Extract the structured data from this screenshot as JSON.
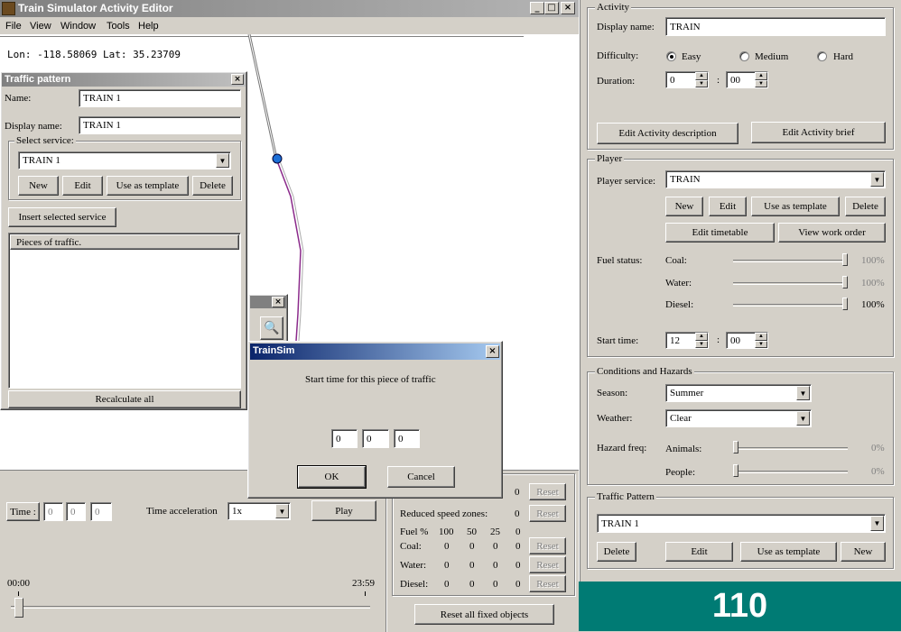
{
  "app": {
    "title": "Train Simulator Activity Editor"
  },
  "menu": [
    "File",
    "View",
    "Window",
    "Tools",
    "Help"
  ],
  "map": {
    "coords": "Lon: -118.58069 Lat: 35.23709"
  },
  "traffic_pattern_win": {
    "title": "Traffic pattern",
    "name_label": "Name:",
    "name_value": "TRAIN 1",
    "display_label": "Display name:",
    "display_value": "TRAIN 1",
    "select_service_label": "Select service:",
    "service_value": "TRAIN 1",
    "new": "New",
    "edit": "Edit",
    "use_template": "Use as template",
    "delete": "Delete",
    "insert": "Insert selected service",
    "pieces_header": "Pieces of traffic.",
    "recalc": "Recalculate all"
  },
  "dialog": {
    "title": "TrainSim",
    "prompt": "Start time for this piece of traffic",
    "h": "0",
    "m": "0",
    "s": "0",
    "ok": "OK",
    "cancel": "Cancel"
  },
  "bottom": {
    "time_label": "Time :",
    "time_h": "0",
    "time_m": "0",
    "time_s": "0",
    "accel_label": "Time acceleration",
    "accel_value": "1x",
    "play": "Play",
    "slider_start": "00:00",
    "slider_end": "23:59"
  },
  "fixed": {
    "row1_value": "0",
    "reset": "Reset",
    "reduced_label": "Reduced speed zones:",
    "reduced_value": "0",
    "fuel_header": "Fuel %",
    "h100": "100",
    "h50": "50",
    "h25": "25",
    "h0": "0",
    "coal": "Coal:",
    "water": "Water:",
    "diesel": "Diesel:",
    "zero": "0",
    "reset_all": "Reset all fixed objects"
  },
  "activity": {
    "group": "Activity",
    "display_label": "Display name:",
    "display_value": "TRAIN",
    "difficulty_label": "Difficulty:",
    "easy": "Easy",
    "medium": "Medium",
    "hard": "Hard",
    "duration_label": "Duration:",
    "dur_h": "0",
    "dur_m": "00",
    "edit_desc": "Edit Activity description",
    "edit_brief": "Edit Activity brief"
  },
  "player": {
    "group": "Player",
    "service_label": "Player service:",
    "service_value": "TRAIN",
    "new": "New",
    "edit": "Edit",
    "use_template": "Use as template",
    "delete": "Delete",
    "edit_timetable": "Edit timetable",
    "view_work_order": "View work order",
    "fuel_label": "Fuel status:",
    "coal": "Coal:",
    "water": "Water:",
    "diesel": "Diesel:",
    "coal_pct": "100%",
    "water_pct": "100%",
    "diesel_pct": "100%",
    "start_label": "Start time:",
    "start_h": "12",
    "start_m": "00"
  },
  "conditions": {
    "group": "Conditions and Hazards",
    "season_label": "Season:",
    "season_value": "Summer",
    "weather_label": "Weather:",
    "weather_value": "Clear",
    "hazard_label": "Hazard freq:",
    "animals": "Animals:",
    "people": "People:",
    "animals_pct": "0%",
    "people_pct": "0%"
  },
  "traffic_group": {
    "group": "Traffic Pattern",
    "value": "TRAIN 1",
    "delete": "Delete",
    "edit": "Edit",
    "use_template": "Use as template",
    "new": "New"
  },
  "badge": "110",
  "colors": {
    "badge_bg": "#007b74",
    "title_active": "#0a246a",
    "title_inactive": "#808080",
    "route": "#8b2a8b",
    "node": "#1c6fd6"
  }
}
